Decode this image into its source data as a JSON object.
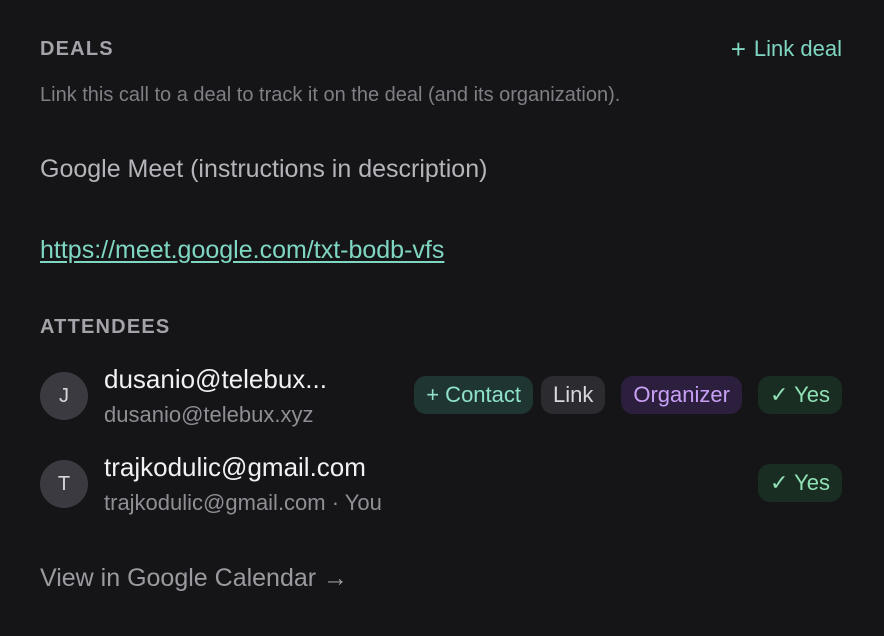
{
  "deals": {
    "title": "DEALS",
    "link_icon": "+",
    "link_label": "Link deal",
    "help": "Link this call to a deal to track it on the deal (and its organization)."
  },
  "meeting": {
    "title": "Google Meet (instructions in description)",
    "url": "https://meet.google.com/txt-bodb-vfs"
  },
  "attendees": {
    "title": "ATTENDEES",
    "items": [
      {
        "initial": "J",
        "name": "dusanio@telebux...",
        "email": "dusanio@telebux.xyz",
        "badges": {
          "contact": "+ Contact",
          "link": "Link",
          "organizer": "Organizer",
          "response": "✓ Yes"
        }
      },
      {
        "initial": "T",
        "name": "trajkodulic@gmail.com",
        "email": "trajkodulic@gmail.com · You",
        "badges": {
          "response": "✓ Yes"
        }
      }
    ]
  },
  "footer": {
    "calendar_link": "View in Google Calendar →"
  },
  "colors": {
    "background": "#151517",
    "accent": "#7fd6c2",
    "organizer": "#c7a0f5",
    "yes": "#8fe0b5"
  }
}
